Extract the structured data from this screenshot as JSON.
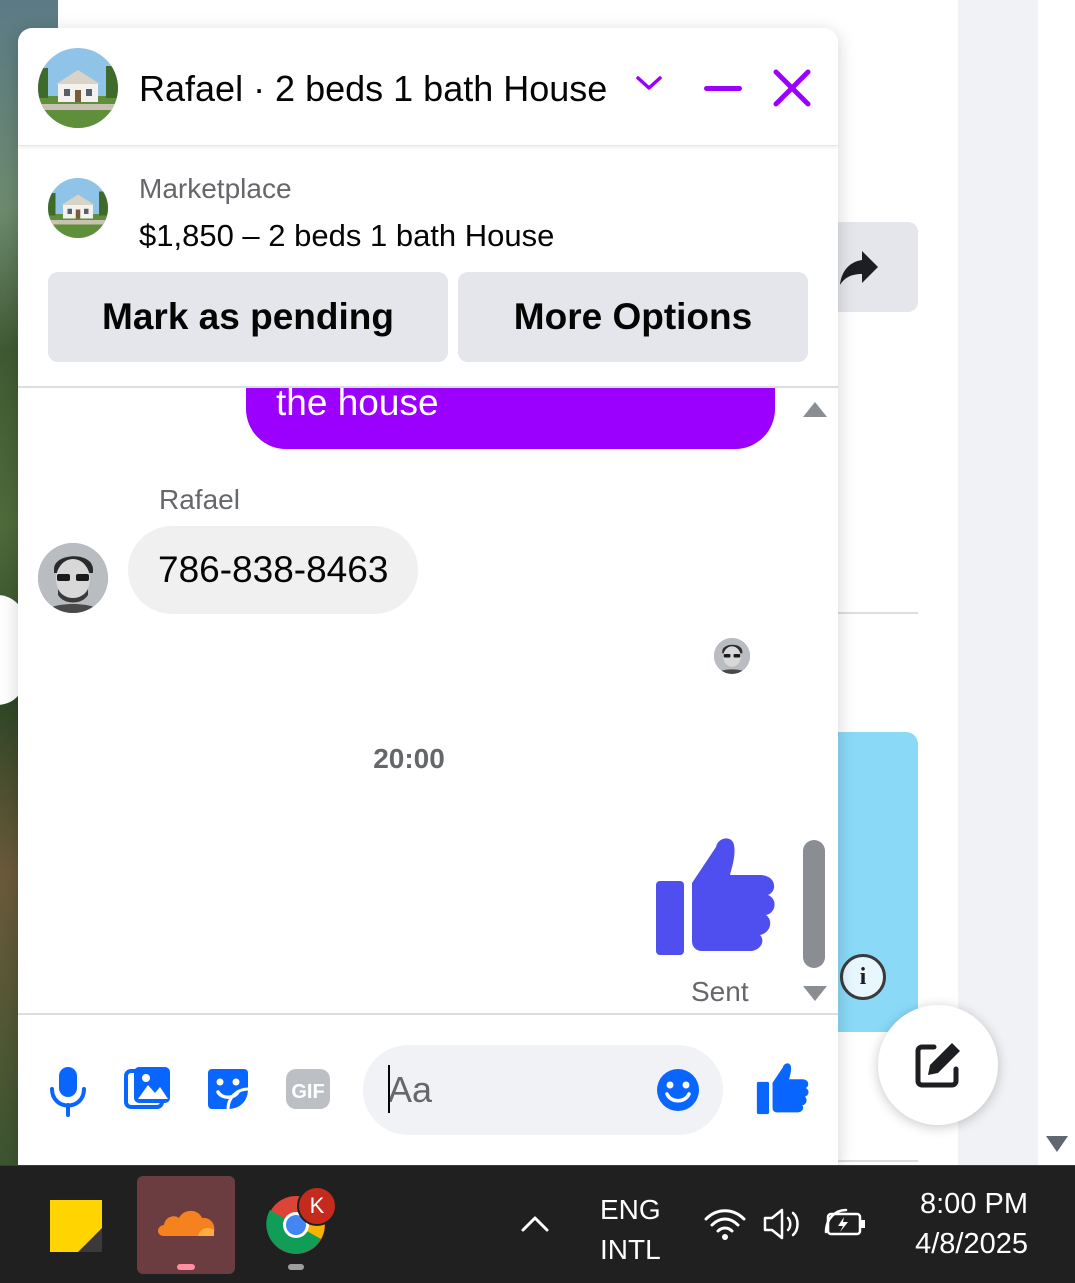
{
  "chat": {
    "title": "Rafael · 2 beds 1 bath House",
    "listing_label": "Marketplace",
    "listing_title": "$1,850 – 2 beds 1 bath House",
    "mark_pending_label": "Mark as pending",
    "more_options_label": "More Options"
  },
  "messages": {
    "outgoing_fragment": "the house",
    "sender_name": "Rafael",
    "incoming_text": "786-838-8463",
    "time_separator": "20:00",
    "sent_status": "Sent"
  },
  "composer": {
    "placeholder": "Aa"
  },
  "taskbar": {
    "chrome_badge": "K",
    "language_line1": "ENG",
    "language_line2": "INTL",
    "time": "8:00 PM",
    "date": "4/8/2025"
  },
  "colors": {
    "accent": "#9b00ff",
    "thumb": "#4f4ff0",
    "composer_icons": "#0866ff"
  },
  "icons": [
    "chevron-down-icon",
    "minimize-icon",
    "close-icon",
    "share-icon",
    "info-icon",
    "compose-icon",
    "microphone-icon",
    "photo-icon",
    "sticker-icon",
    "gif-icon",
    "emoji-icon",
    "thumbs-up-icon",
    "sticky-notes-icon",
    "cloudflare-icon",
    "chrome-icon",
    "chevron-up-icon",
    "wifi-icon",
    "volume-icon",
    "battery-icon"
  ]
}
